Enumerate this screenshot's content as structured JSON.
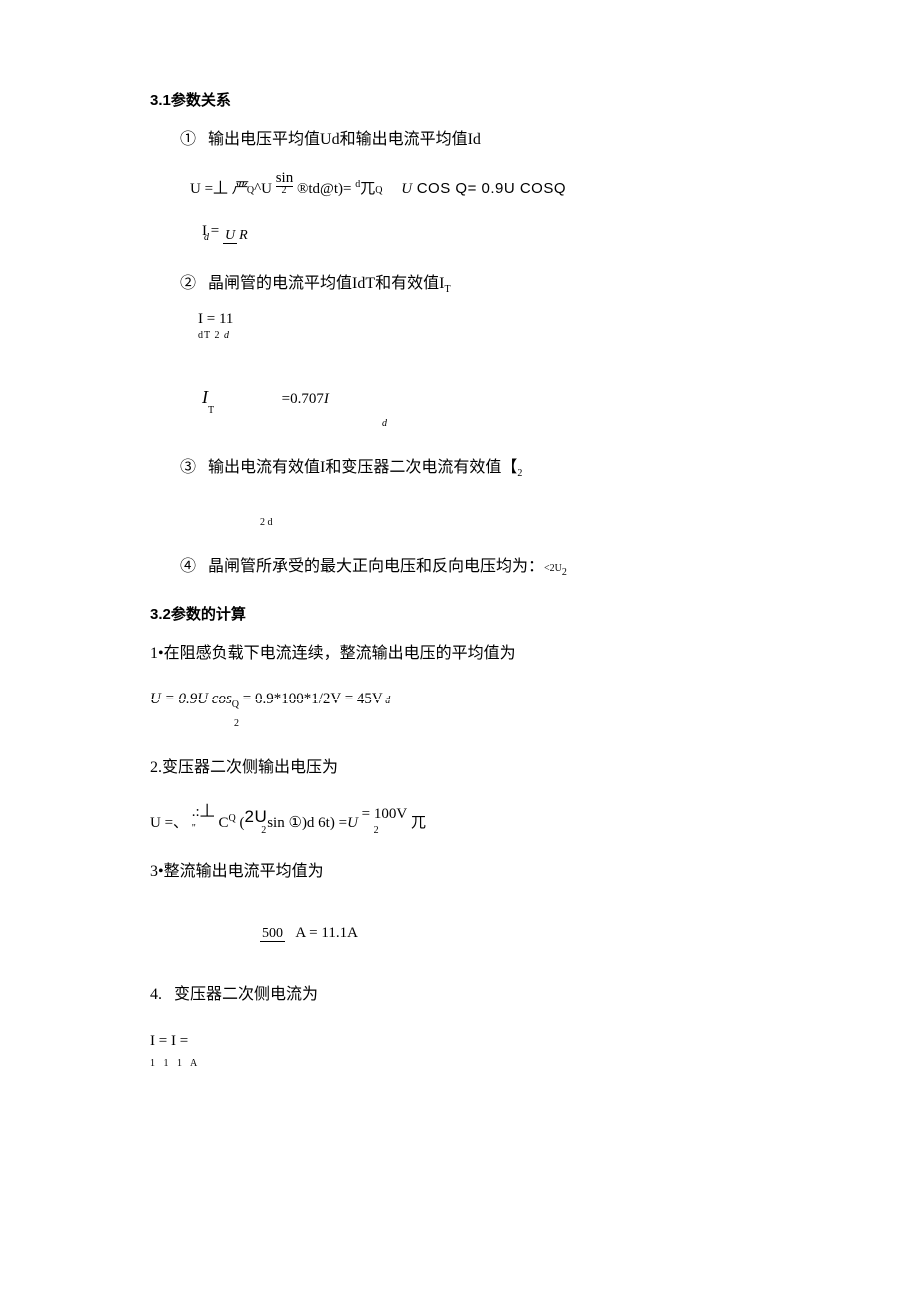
{
  "section1": {
    "title": "3.1参数关系",
    "items": [
      {
        "bullet": "①",
        "text": "输出电压平均值Ud和输出电流平均值Id",
        "formula1_lhs": "U =",
        "formula1_perp": "丄",
        "formula1_mid": " 严",
        "formula1_q": "Q",
        "formula1_caret": "^U ",
        "formula1_sin": "sin",
        "formula1_sin_sub": "2",
        "formula1_rtd": " ®td@t)= ",
        "formula1_d": "d",
        "formula1_pi": "兀",
        "formula1_q2": "Q",
        "formula1_cos1": "U",
        "formula1_cos1b": " COS ",
        "formula1_cos1q": "Q",
        "formula1_cos1eq": "= 0.9U COS",
        "formula1_cos1q2": "Q",
        "formula2_I": "I = ",
        "formula2_dsub": "d",
        "formula2_U": "U",
        "formula2_R": "R"
      },
      {
        "bullet": "②",
        "text": "晶闸管的电流平均值IdT和有效值I",
        "text_sub": "T",
        "formula1_I": "I = 1",
        "formula1_val": "1",
        "formula1_sub": "dT",
        "formula1_sub2": "2",
        "formula1_sub3": "d",
        "formula2_I": "I",
        "formula2_T": "T",
        "formula2_eq": "=0.707",
        "formula2_I2": "I",
        "formula2_d": "d"
      },
      {
        "bullet": "③",
        "text": "输出电流有效值I和变压器二次电流有效值【",
        "text_sub": "2",
        "formula_sub": "2 d"
      },
      {
        "bullet": "④",
        "text": "晶闸管所承受的最大正向电压和反向电压均为：",
        "text_tail": "<2U",
        "text_tail_sub": "2"
      }
    ]
  },
  "section2": {
    "title": "3.2参数的计算",
    "items": [
      {
        "num": "1•",
        "text": "在阻感负载下电流连续，整流输出电压的平均值为",
        "formula": "U = 0.9U cos",
        "formula_q": "Q",
        "formula_sub": "2",
        "formula_rhs": " = 0.9*100*1/2V = 45V",
        "formula_d": " d"
      },
      {
        "num": "2.",
        "text": "变压器二次侧输出电压为",
        "formula_lhs": "U =、",
        "formula_dots": ".:",
        "formula_perp": "丄",
        "formula_quote": "\"",
        "formula_C": " C",
        "formula_Q": "Q",
        "formula_paren": "(",
        "formula_2U": "2U",
        "formula_2U_sub": "2",
        "formula_sin": "sin",
        "formula_circ": "①",
        "formula_d6t": ")d 6t) =",
        "formula_U_eq": "U",
        "formula_eq100": " = 100V",
        "formula_100_sub": "2",
        "formula_pi": " 兀"
      },
      {
        "num": "3•",
        "text": "整流输出电流平均值为",
        "formula_frac_top": "500",
        "formula_A": " A = 11.1A"
      },
      {
        "num": "4.",
        "text": "变压器二次侧电流为",
        "formula": "I = I =",
        "formula_sub": "1 1 1 A"
      }
    ]
  }
}
